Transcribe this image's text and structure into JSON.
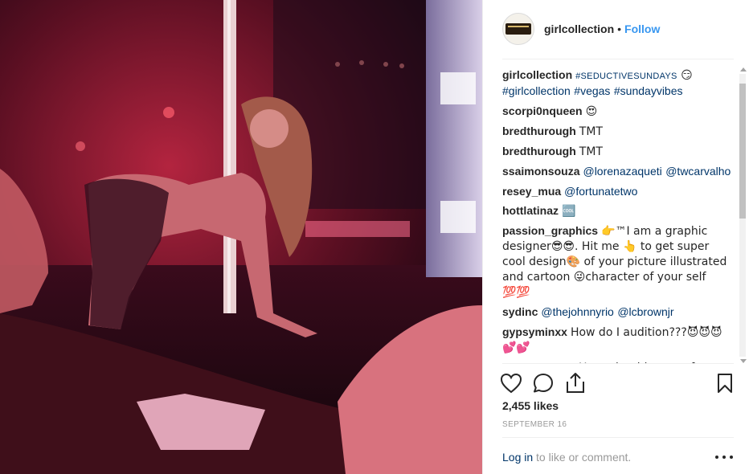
{
  "header": {
    "username": "girlcollection",
    "separator": "•",
    "follow_label": "Follow"
  },
  "comments": [
    {
      "user": "girlcollection",
      "segments": [
        {
          "text": "#SEDUCTIVESUNDAYS",
          "type": "tag-small"
        },
        {
          "text": " 😏",
          "type": "text"
        },
        {
          "text": "#girlcollection",
          "type": "tag"
        },
        {
          "text": " ",
          "type": "text"
        },
        {
          "text": "#vegas",
          "type": "tag"
        },
        {
          "text": " ",
          "type": "text"
        },
        {
          "text": "#sundayvibes",
          "type": "tag"
        }
      ]
    },
    {
      "user": "scorpi0nqueen",
      "segments": [
        {
          "text": "😍",
          "type": "text"
        }
      ]
    },
    {
      "user": "bredthurough",
      "segments": [
        {
          "text": "TMT",
          "type": "text"
        }
      ]
    },
    {
      "user": "bredthurough",
      "segments": [
        {
          "text": "TMT",
          "type": "text"
        }
      ]
    },
    {
      "user": "ssaimonsouza",
      "segments": [
        {
          "text": "@lorenazaqueti",
          "type": "tag"
        },
        {
          "text": " ",
          "type": "text"
        },
        {
          "text": "@twcarvalho",
          "type": "tag"
        }
      ]
    },
    {
      "user": "resey_mua",
      "segments": [
        {
          "text": "@fortunatetwo",
          "type": "tag"
        }
      ]
    },
    {
      "user": "hottlatinaz",
      "segments": [
        {
          "text": "🆒",
          "type": "text"
        }
      ]
    },
    {
      "user": "passion_graphics",
      "segments": [
        {
          "text": "👉™I am a graphic designer😎😎. Hit me 👆 to get super cool design🎨 of your picture illustrated and cartoon 😜character of your self 💯💯",
          "type": "text"
        }
      ]
    },
    {
      "user": "sydinc",
      "segments": [
        {
          "text": "@thejohnnyrio",
          "type": "tag"
        },
        {
          "text": " ",
          "type": "text"
        },
        {
          "text": "@lcbrownjr",
          "type": "tag"
        }
      ]
    },
    {
      "user": "gypsyminxx",
      "segments": [
        {
          "text": "How do I audition???😈😈😈💕💕",
          "type": "text"
        }
      ]
    },
    {
      "user": "zamarazayani",
      "segments": [
        {
          "text": "U need to hire me after my",
          "type": "text"
        }
      ]
    }
  ],
  "actions": {
    "like": "heart-icon",
    "comment": "comment-icon",
    "share": "share-icon",
    "save": "bookmark-icon"
  },
  "likes_label": "2,455 likes",
  "date_label": "SEPTEMBER 16",
  "footer": {
    "login_label": "Log in",
    "rest_label": " to like or comment."
  },
  "colors": {
    "link": "#003569",
    "follow": "#3897f0",
    "muted": "#999999",
    "text": "#262626"
  }
}
